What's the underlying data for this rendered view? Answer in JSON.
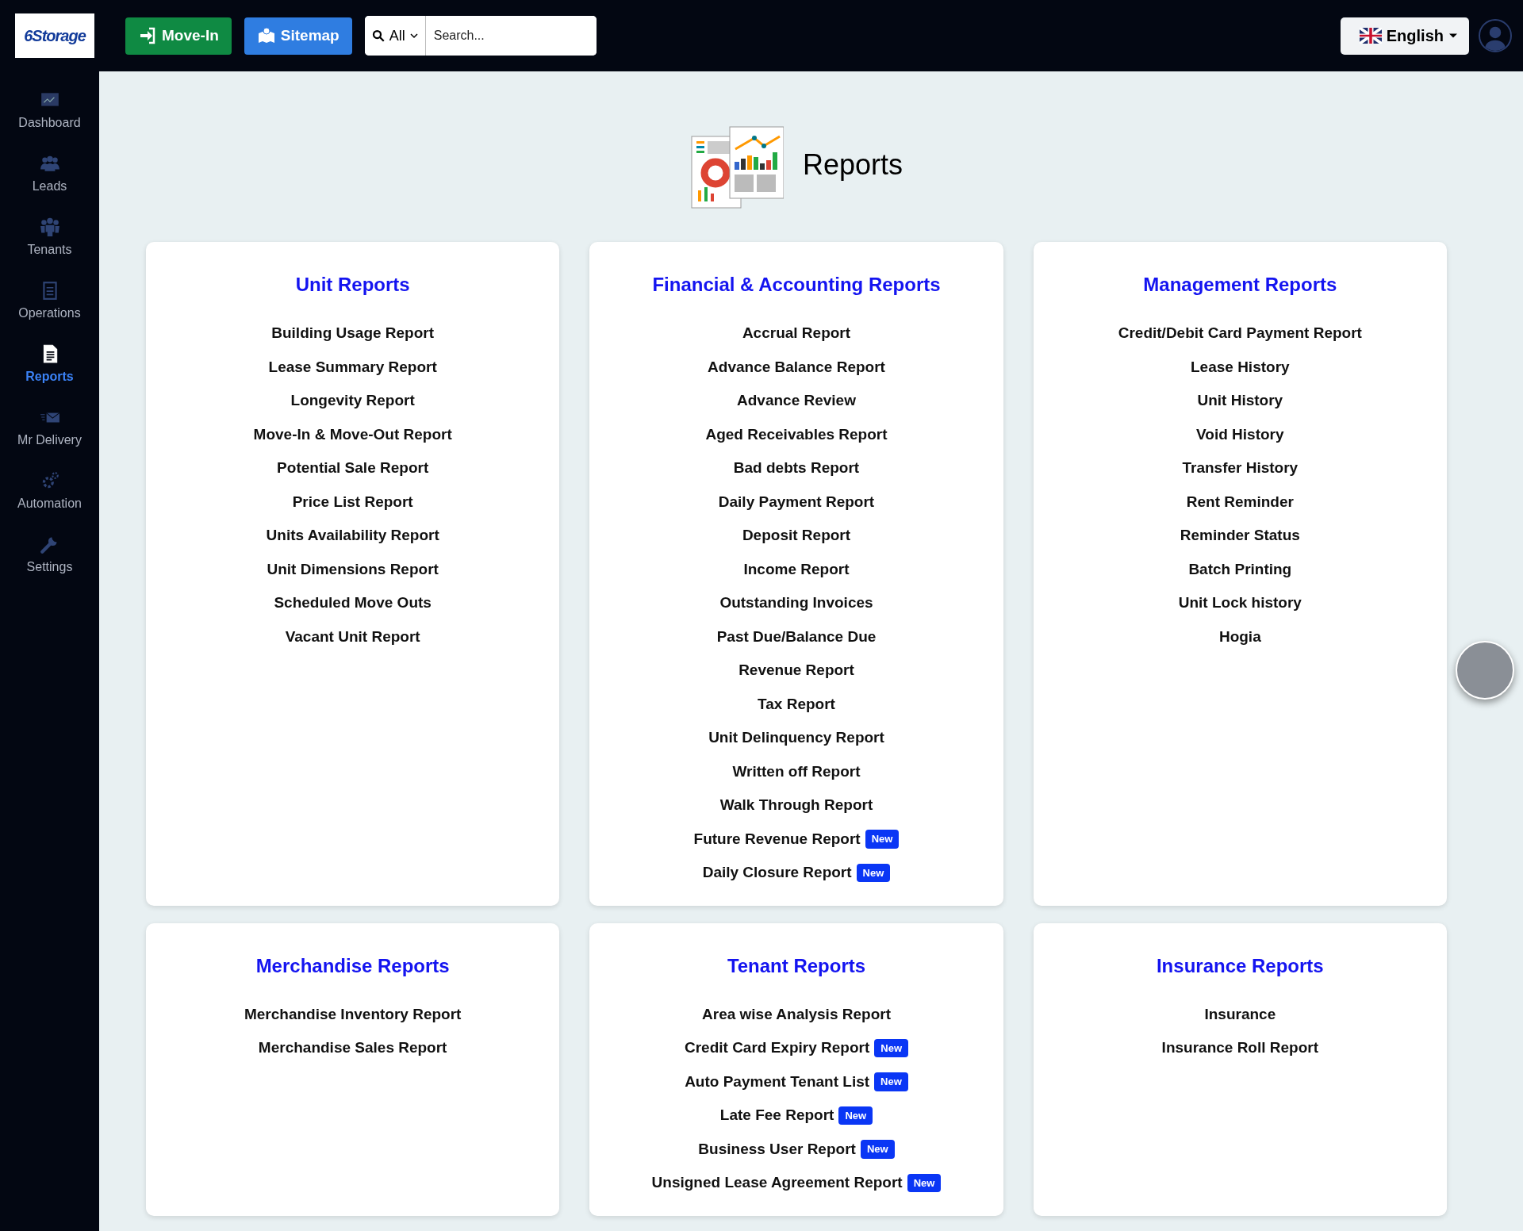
{
  "logo": {
    "text": "6Storage"
  },
  "topbar": {
    "buttons": [
      {
        "label": "Move-In",
        "kind": "movein"
      },
      {
        "label": "Sitemap",
        "kind": "sitemap"
      }
    ],
    "search": {
      "scope": "All",
      "placeholder": "Search..."
    },
    "language": "English"
  },
  "sidebar": {
    "items": [
      {
        "label": "Dashboard",
        "selected": false
      },
      {
        "label": "Leads",
        "selected": false
      },
      {
        "label": "Tenants",
        "selected": false
      },
      {
        "label": "Operations",
        "selected": false
      },
      {
        "label": "Reports",
        "selected": true
      },
      {
        "label": "Mr Delivery",
        "selected": false
      },
      {
        "label": "Automation",
        "selected": false
      },
      {
        "label": "Settings",
        "selected": false
      }
    ]
  },
  "page": {
    "title": "Reports"
  },
  "sections": [
    {
      "title": "Unit Reports",
      "items": [
        {
          "label": "Building Usage Report"
        },
        {
          "label": "Lease Summary Report"
        },
        {
          "label": "Longevity Report"
        },
        {
          "label": "Move-In & Move-Out Report"
        },
        {
          "label": "Potential Sale Report"
        },
        {
          "label": "Price List Report"
        },
        {
          "label": "Units Availability Report"
        },
        {
          "label": "Unit Dimensions Report"
        },
        {
          "label": "Scheduled Move Outs"
        },
        {
          "label": "Vacant Unit Report"
        }
      ]
    },
    {
      "title": "Financial & Accounting Reports",
      "items": [
        {
          "label": "Accrual Report"
        },
        {
          "label": "Advance Balance Report"
        },
        {
          "label": "Advance Review"
        },
        {
          "label": "Aged Receivables Report"
        },
        {
          "label": "Bad debts Report"
        },
        {
          "label": "Daily Payment Report"
        },
        {
          "label": "Deposit Report"
        },
        {
          "label": "Income Report"
        },
        {
          "label": "Outstanding Invoices"
        },
        {
          "label": "Past Due/Balance Due"
        },
        {
          "label": "Revenue Report"
        },
        {
          "label": "Tax Report"
        },
        {
          "label": "Unit Delinquency Report"
        },
        {
          "label": "Written off Report"
        },
        {
          "label": "Walk Through Report"
        },
        {
          "label": "Future Revenue Report",
          "badge": "New"
        },
        {
          "label": "Daily Closure Report",
          "badge": "New"
        }
      ]
    },
    {
      "title": "Management Reports",
      "items": [
        {
          "label": "Credit/Debit Card Payment Report"
        },
        {
          "label": "Lease History"
        },
        {
          "label": "Unit History"
        },
        {
          "label": "Void History"
        },
        {
          "label": "Transfer History"
        },
        {
          "label": "Rent Reminder"
        },
        {
          "label": "Reminder Status"
        },
        {
          "label": "Batch Printing"
        },
        {
          "label": "Unit Lock history"
        },
        {
          "label": "Hogia"
        }
      ]
    },
    {
      "title": "Merchandise Reports",
      "items": [
        {
          "label": "Merchandise Inventory Report"
        },
        {
          "label": "Merchandise Sales Report"
        }
      ]
    },
    {
      "title": "Tenant Reports",
      "items": [
        {
          "label": "Area wise Analysis Report"
        },
        {
          "label": "Credit Card Expiry Report",
          "badge": "New"
        },
        {
          "label": "Auto Payment Tenant List",
          "badge": "New"
        },
        {
          "label": "Late Fee Report",
          "badge": "New"
        },
        {
          "label": "Business User Report",
          "badge": "New"
        },
        {
          "label": "Unsigned Lease Agreement Report",
          "badge": "New"
        }
      ]
    },
    {
      "title": "Insurance Reports",
      "items": [
        {
          "label": "Insurance"
        },
        {
          "label": "Insurance Roll Report"
        }
      ]
    }
  ]
}
